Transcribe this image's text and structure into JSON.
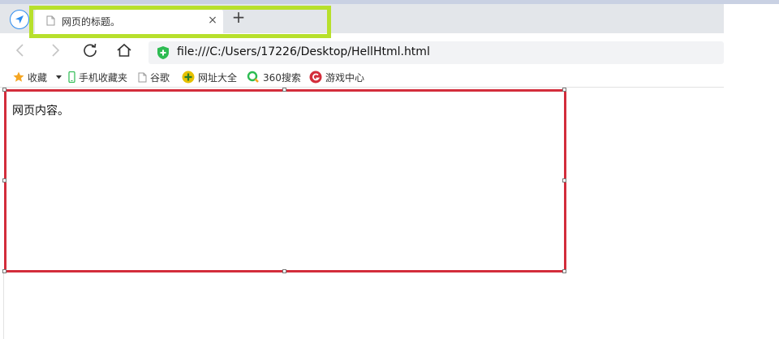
{
  "browser": {
    "tab": {
      "title": "网页的标题。",
      "close_glyph": "×"
    },
    "new_tab_glyph": "+",
    "address": {
      "url": "file:///C:/Users/17226/Desktop/HellHtml.html"
    },
    "bookmarks": [
      {
        "label": "收藏",
        "icon": "star-icon"
      },
      {
        "label": "手机收藏夹",
        "icon": "phone-icon"
      },
      {
        "label": "谷歌",
        "icon": "document-icon"
      },
      {
        "label": "网址大全",
        "icon": "plus-circle-icon"
      },
      {
        "label": "360搜索",
        "icon": "search-360-icon"
      },
      {
        "label": "游戏中心",
        "icon": "game-icon"
      }
    ]
  },
  "page": {
    "content": "网页内容。"
  },
  "colors": {
    "highlight": "#b7e02c",
    "selection": "#d32d3b",
    "accent": "#2d8cf0"
  }
}
